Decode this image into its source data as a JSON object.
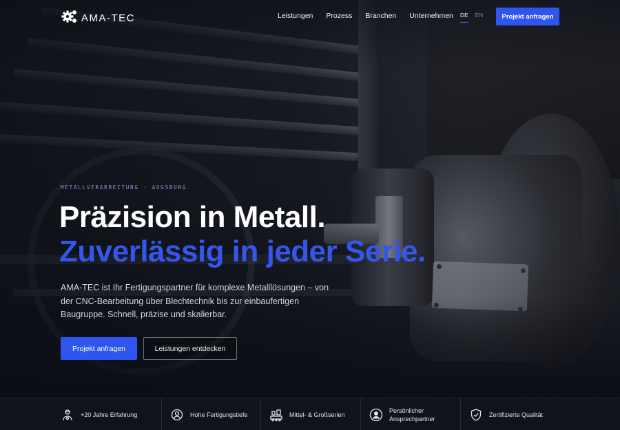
{
  "header": {
    "logo_text": "AMA-TEC",
    "logo_icon": "gear-cluster-icon",
    "nav": [
      {
        "label": "Leistungen"
      },
      {
        "label": "Prozess"
      },
      {
        "label": "Branchen"
      },
      {
        "label": "Unternehmen"
      }
    ],
    "languages": [
      {
        "code": "DE",
        "active": true
      },
      {
        "code": "EN",
        "active": false
      }
    ],
    "cta_label": "Projekt anfragen"
  },
  "hero": {
    "eyebrow": "METALLVERARBEITUNG · AUGSBURG",
    "headline_line1": "Präzision in Metall.",
    "headline_line2": "Zuverlässig in jeder Serie.",
    "lead": "AMA-TEC ist Ihr Fertigungspartner für komplexe Metalllösungen – von der CNC-Bearbeitung über Blechtechnik bis zur einbaufertigen Baugruppe. Schnell, präzise und skalierbar.",
    "primary_button": "Projekt anfragen",
    "secondary_button": "Leistungen entdecken",
    "background": "cnc-machine-spindle-photo"
  },
  "features": [
    {
      "icon": "worker-gear-icon",
      "label": "+20 Jahre Erfahrung"
    },
    {
      "icon": "gear-head-icon",
      "label": "Hohe Fertigungstiefe"
    },
    {
      "icon": "production-line-icon",
      "label": "Mittel- & Großserien"
    },
    {
      "icon": "person-circle-icon",
      "label": "Persönlicher Ansprechpartner"
    },
    {
      "icon": "shield-check-icon",
      "label": "Zertifizierte Qualität"
    }
  ],
  "colors": {
    "accent": "#2e55ef",
    "headline_accent": "#3456ec",
    "eyebrow": "#8c95d6",
    "feature_bar": "#11131b"
  }
}
